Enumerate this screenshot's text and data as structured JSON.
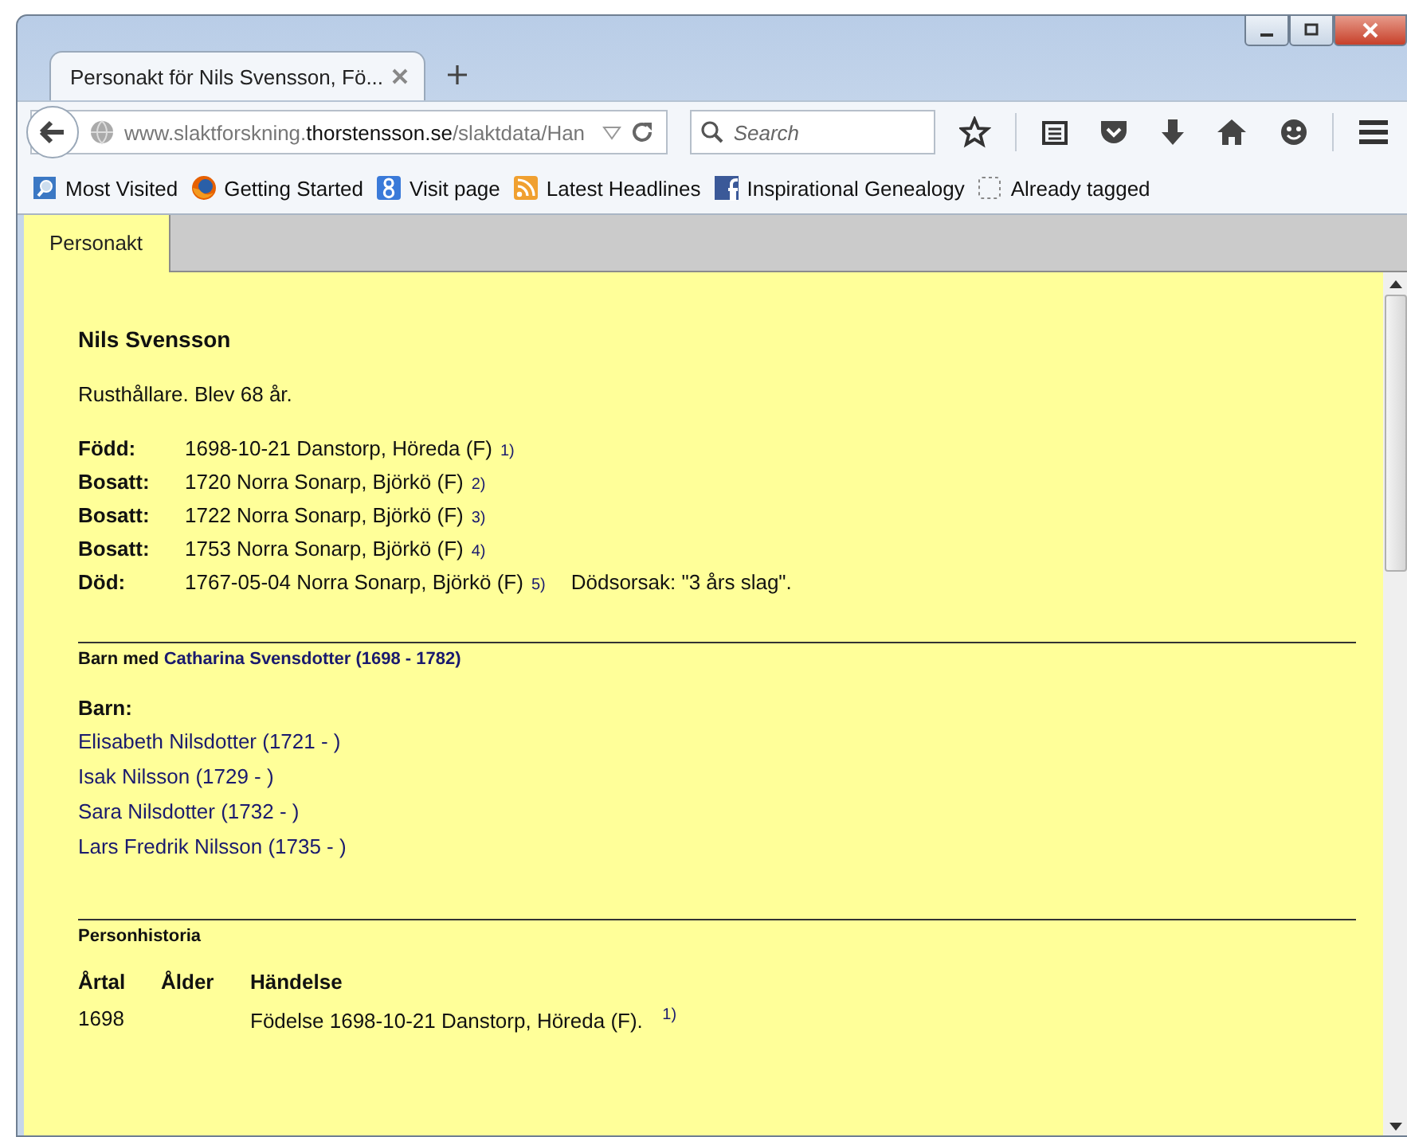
{
  "browser_tab": {
    "title": "Personakt för Nils Svensson, Fö...",
    "selected": true
  },
  "address_bar": {
    "url_prefix": "www.slaktforskning.",
    "url_domain": "thorstensson.se",
    "url_path": "/slaktdata/Han"
  },
  "search": {
    "placeholder": "Search"
  },
  "bookmarks": [
    {
      "kind": "most-visited",
      "label": "Most Visited"
    },
    {
      "kind": "firefox",
      "label": "Getting Started"
    },
    {
      "kind": "google",
      "label": "Visit page"
    },
    {
      "kind": "rss",
      "label": "Latest Headlines"
    },
    {
      "kind": "facebook",
      "label": "Inspirational Genealogy"
    },
    {
      "kind": "blank",
      "label": "Already tagged"
    }
  ],
  "page_tabs": [
    {
      "label": "Personakt",
      "selected": true
    }
  ],
  "person": {
    "name": "Nils Svensson",
    "summary": "Rusthållare. Blev 68 år.",
    "events": [
      {
        "label": "Född:",
        "text": "1698-10-21 Danstorp, Höreda (F)",
        "note": "1)"
      },
      {
        "label": "Bosatt:",
        "text": "1720 Norra Sonarp, Björkö (F)",
        "note": "2)"
      },
      {
        "label": "Bosatt:",
        "text": "1722 Norra Sonarp, Björkö (F)",
        "note": "3)"
      },
      {
        "label": "Bosatt:",
        "text": "1753 Norra Sonarp, Björkö (F)",
        "note": "4)"
      },
      {
        "label": "Död:",
        "text": "1767-05-04 Norra Sonarp, Björkö (F)",
        "note": "5)",
        "cause": "Dödsorsak: \"3 års slag\"."
      }
    ]
  },
  "family": {
    "heading": "Barn med",
    "partner": "Catharina Svensdotter (1698 - 1782)",
    "children_label": "Barn:",
    "children": [
      "Elisabeth Nilsdotter (1721 - )",
      "Isak Nilsson (1729 - )",
      "Sara Nilsdotter (1732 - )",
      "Lars Fredrik Nilsson (1735 - )"
    ]
  },
  "history": {
    "heading": "Personhistoria",
    "columns": [
      "Årtal",
      "Ålder",
      "Händelse"
    ],
    "rows": [
      {
        "year": "1698",
        "age": "",
        "event": "Födelse 1698-10-21 Danstorp, Höreda (F).",
        "note": "1)"
      }
    ]
  }
}
